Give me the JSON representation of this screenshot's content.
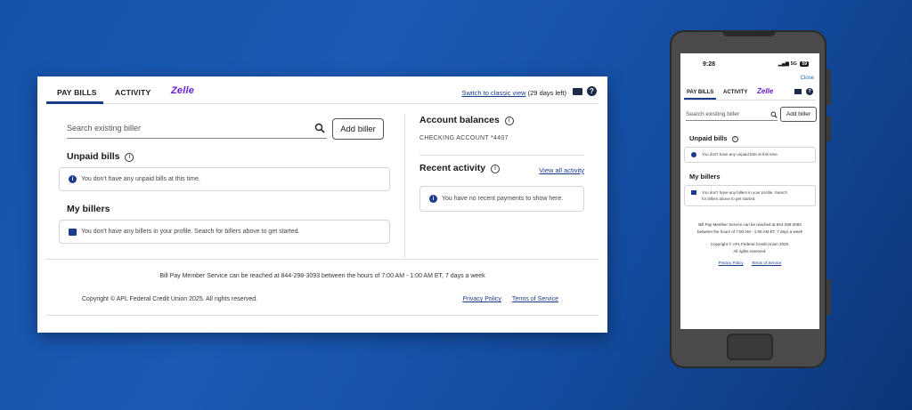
{
  "desktop": {
    "tabs": [
      "PAY BILLS",
      "ACTIVITY"
    ],
    "zelle": "Zelle",
    "classic_link": "Switch to classic view",
    "classic_days": "(29 days left)",
    "help_glyph": "?",
    "search": {
      "placeholder": "Search existing biller"
    },
    "add_biller": "Add biller",
    "unpaid_bills": {
      "title": "Unpaid bills",
      "message": "You don't have any unpaid bills at this time."
    },
    "my_billers": {
      "title": "My billers",
      "message": "You don't have any billers in your profile. Search for billers above to get started."
    },
    "account_balances": {
      "title": "Account balances",
      "account": "CHECKING ACCOUNT *4407"
    },
    "recent_activity": {
      "title": "Recent activity",
      "view_all": "View all activity",
      "message": "You have no recent payments to show here."
    },
    "footer": {
      "service_line": "Bill Pay Member Service can be reached at 844-298-3093 between the hours of 7:00 AM - 1:00 AM ET, 7 days a week",
      "copyright": "Copyright © APL Federal Credit Union 2025.  All rights reserved.",
      "privacy": "Privacy Policy",
      "terms": "Terms of Service"
    }
  },
  "mobile": {
    "time": "9:28",
    "network": "5G",
    "battery": "59",
    "close": "Close",
    "tabs": [
      "PAY BILLS",
      "ACTIVITY"
    ],
    "zelle": "Zelle",
    "help_glyph": "?",
    "search_placeholder": "Search existing biller",
    "add_biller": "Add biller",
    "unpaid_title": "Unpaid bills",
    "unpaid_message": "You don't have any unpaid bills at this time.",
    "billers_title": "My billers",
    "billers_message_1": "You don't have any billers in your profile. Search",
    "billers_message_2": "for billers above to get started.",
    "service_1": "Bill Pay Member Service can be reached at 844-298-3093",
    "service_2": "between the hours of 7:00 AM - 1:00 AM ET, 7 days a week",
    "copyright_1": "Copyright © APL Federal Credit Union 2025.",
    "copyright_2": "All rights reserved.",
    "privacy": "Privacy Policy",
    "terms": "Terms of Service"
  },
  "icons": {
    "info_glyph": "i",
    "search": "search-icon",
    "mail": "mail-icon",
    "help": "help-icon",
    "store": "store-icon"
  },
  "colors": {
    "background": "#1452a8",
    "accent": "#1a3c8c",
    "zelle": "#6d1ed4"
  }
}
